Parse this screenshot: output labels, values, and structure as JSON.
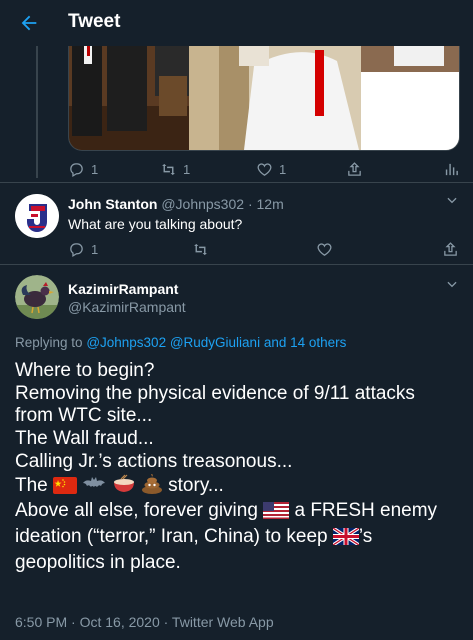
{
  "header": {
    "title": "Tweet",
    "back_icon": "back-arrow-icon"
  },
  "parent_tweet": {
    "actions": {
      "reply_count": "1",
      "retweet_count": "1",
      "like_count": "1"
    }
  },
  "reply": {
    "name": "John Stanton",
    "handle": "@Johnps302",
    "separator": "·",
    "time": "12m",
    "text": "What are you talking about?",
    "actions": {
      "reply_count": "1"
    }
  },
  "main_tweet": {
    "name": "KazimirRampant",
    "handle": "@KazimirRampant",
    "replying_prefix": "Replying to",
    "replying_users": "@Johnps302 @RudyGiuliani and 14 others",
    "lines": {
      "l1": "Where to begin?",
      "l2": "Removing the physical evidence of 9/11 attacks",
      "l3": "from WTC site...",
      "l4": "The Wall fraud...",
      "l5": "Calling Jr.’s actions treasonous...",
      "l6_start": "The",
      "l6_end": "story...",
      "l7_start": "Above all else, forever giving",
      "l7_end": "a FRESH enemy",
      "l8": "ideation (“terror,” Iran, China) to keep",
      "l8_end": "’s",
      "l9": "geopolitics in place."
    },
    "timestamp": "6:50 PM · Oct 16, 2020 · Twitter Web App"
  },
  "colors": {
    "background": "#15202b",
    "accent": "#1da1f2",
    "muted": "#8899a6",
    "border": "#38444d"
  }
}
